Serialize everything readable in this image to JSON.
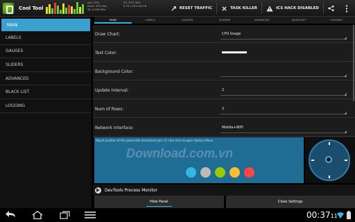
{
  "app": {
    "title": "Cool Tool",
    "monitor_lines": [
      "cpu: 71%",
      "mem: 47%  free",
      "10: 4,200 MHz",
      "52: 79°C AVG",
      "0.75 1.25 0.44 0.8"
    ],
    "actions": [
      {
        "label": "RESET TRAFFIC",
        "icon": "reset-icon"
      },
      {
        "label": "TASK KILLER",
        "icon": "close-icon"
      },
      {
        "label": "ICS HACK DISABLED",
        "icon": "warning-icon"
      }
    ]
  },
  "sidebar": {
    "items": [
      {
        "label": "MAIN",
        "active": true
      },
      {
        "label": "LABELS"
      },
      {
        "label": "GAUGES"
      },
      {
        "label": "SLIDERS"
      },
      {
        "label": "ADVANCED"
      },
      {
        "label": "BLACK LIST"
      },
      {
        "label": "LOGGING"
      }
    ]
  },
  "tabs": [
    "MAIN",
    "LABELS",
    "GAUGES",
    "SLIDERS",
    "ADVANCED",
    "BLACKLIST",
    "LOGGING"
  ],
  "settings": [
    {
      "label": "Draw Chart:",
      "value": "CPU Usage"
    },
    {
      "label": "Text Color:",
      "swatch": "#ffffff"
    },
    {
      "label": "Background Color:",
      "swatch": "#000000"
    },
    {
      "label": "Update Interval:",
      "value": "2"
    },
    {
      "label": "Num of Rows:",
      "value": "2"
    },
    {
      "label": "Network Interface:",
      "value": "Mobile+WiFi"
    }
  ],
  "preview": {
    "hint": "Adjust position of the panel with directional pad. Or click here to open Options Menu",
    "watermark": "Download.com.vn",
    "dot_colors": [
      "#33b5e5",
      "#bbbbbb",
      "#99cc00",
      "#ffbb33",
      "#ff4444"
    ]
  },
  "process_monitor": {
    "label": "DevTools Process Monitor"
  },
  "buttons": {
    "hide": "Hide Panel",
    "close": "Close Settings"
  },
  "system": {
    "time": "00:37",
    "seconds": "11"
  }
}
